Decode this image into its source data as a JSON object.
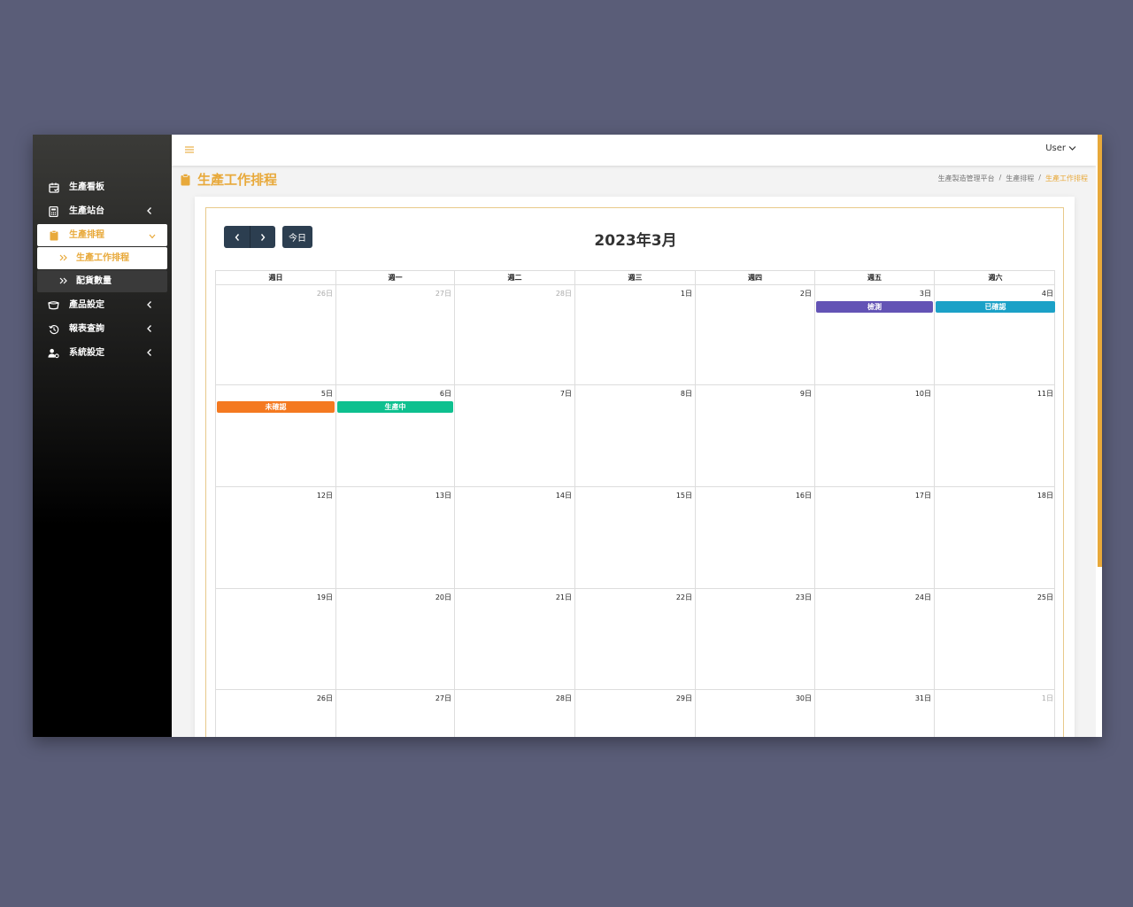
{
  "sidebar": {
    "items": [
      {
        "label": "生產看板",
        "icon": "calendar-check-icon"
      },
      {
        "label": "生產站台",
        "icon": "calculator-icon"
      },
      {
        "label": "生產排程",
        "icon": "clipboard-icon"
      },
      {
        "label": "產品設定",
        "icon": "product-icon"
      },
      {
        "label": "報表查詢",
        "icon": "history-icon"
      },
      {
        "label": "系統設定",
        "icon": "user-gear-icon"
      }
    ],
    "sub_items": [
      {
        "label": "生產工作排程",
        "icon": "double-chevron-icon"
      },
      {
        "label": "配貨數量",
        "icon": "double-chevron-icon"
      }
    ]
  },
  "topbar": {
    "menu_icon": "hamburger-icon",
    "user_label": "User"
  },
  "page": {
    "title": "生產工作排程",
    "breadcrumb": [
      "生產製造管理平台",
      "/",
      "生產排程",
      "/",
      "生產工作排程"
    ]
  },
  "calendar": {
    "title": "2023年3月",
    "today_label": "今日",
    "weekdays": [
      "週日",
      "週一",
      "週二",
      "週三",
      "週四",
      "週五",
      "週六"
    ],
    "weeks": [
      [
        "26日",
        "27日",
        "28日",
        "1日",
        "2日",
        "3日",
        "4日"
      ],
      [
        "5日",
        "6日",
        "7日",
        "8日",
        "9日",
        "10日",
        "11日"
      ],
      [
        "12日",
        "13日",
        "14日",
        "15日",
        "16日",
        "17日",
        "18日"
      ],
      [
        "19日",
        "20日",
        "21日",
        "22日",
        "23日",
        "24日",
        "25日"
      ],
      [
        "26日",
        "27日",
        "28日",
        "29日",
        "30日",
        "31日",
        "1日"
      ]
    ],
    "events": [
      {
        "label": "檢測",
        "color": "#6353b5"
      },
      {
        "label": "已確認",
        "color": "#1ba1c7"
      },
      {
        "label": "未確認",
        "color": "#f47920"
      },
      {
        "label": "生產中",
        "color": "#0ec08f"
      }
    ]
  },
  "colors": {
    "accent": "#e8a93a",
    "button": "#2c3e50"
  }
}
